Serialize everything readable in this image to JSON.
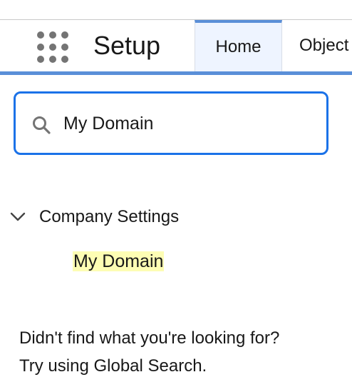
{
  "header": {
    "app_title": "Setup",
    "app_launcher_icon": "app-launcher-grid-icon",
    "tabs": [
      {
        "label": "Home",
        "selected": true
      },
      {
        "label": "Object",
        "selected": false
      }
    ],
    "accent_color": "#5a8fd8"
  },
  "search": {
    "value": "My Domain",
    "icon": "search-icon",
    "focus_color": "#1b72e8"
  },
  "results": {
    "group": {
      "label": "Company Settings",
      "expanded": true,
      "icon": "chevron-down-icon"
    },
    "items": [
      {
        "label": "My Domain",
        "highlight_color": "#fdfdb4"
      }
    ]
  },
  "help": {
    "line1": "Didn't find what you're looking for?",
    "line2": "Try using Global Search."
  }
}
